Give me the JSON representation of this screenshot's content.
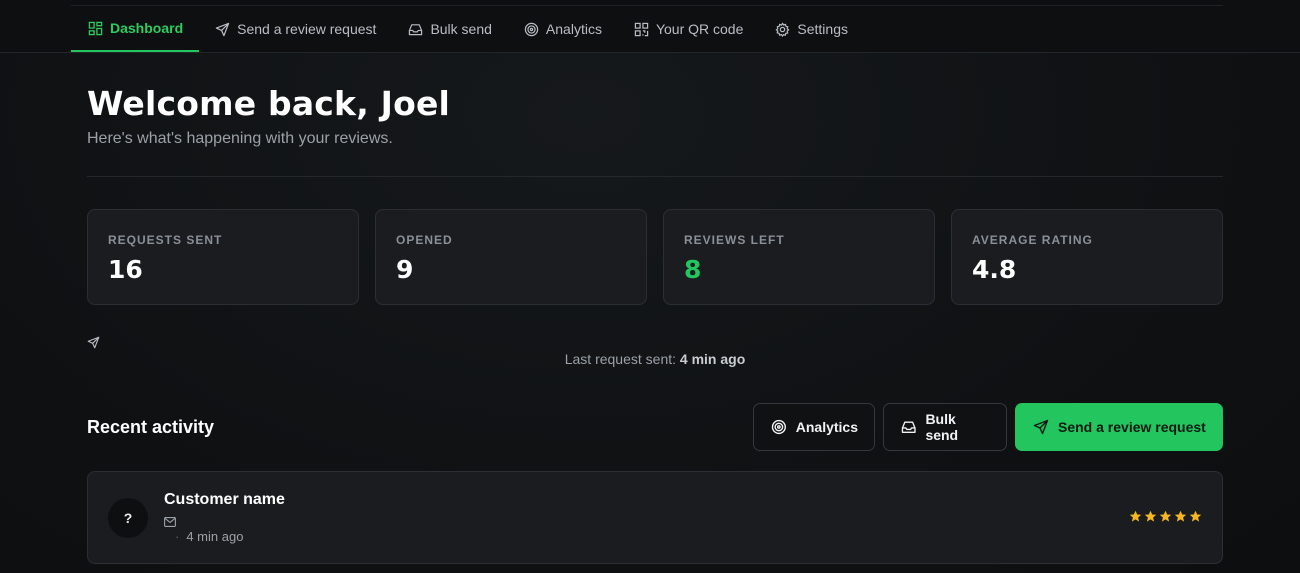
{
  "nav": {
    "items": [
      {
        "label": "Dashboard",
        "icon": "grid-icon",
        "active": true
      },
      {
        "label": "Send a review request",
        "icon": "send-icon",
        "active": false
      },
      {
        "label": "Bulk send",
        "icon": "inbox-icon",
        "active": false
      },
      {
        "label": "Analytics",
        "icon": "target-icon",
        "active": false
      },
      {
        "label": "Your QR code",
        "icon": "qr-code-icon",
        "active": false
      },
      {
        "label": "Settings",
        "icon": "gear-icon",
        "active": false
      }
    ]
  },
  "header": {
    "title": "Welcome back, Joel",
    "subtitle": "Here's what's happening with your reviews."
  },
  "stats": [
    {
      "label": "REQUESTS SENT",
      "value": "16"
    },
    {
      "label": "OPENED",
      "value": "9"
    },
    {
      "label": "REVIEWS LEFT",
      "value": "8"
    },
    {
      "label": "AVERAGE RATING",
      "value": "4.8"
    }
  ],
  "last_sent": {
    "prefix": "Last request sent: ",
    "value": "4 min ago"
  },
  "recent": {
    "title": "Recent activity",
    "buttons": {
      "analytics": "Analytics",
      "bulk": "Bulk send",
      "send": "Send a review request"
    },
    "rows": [
      {
        "avatar": "?",
        "name": "Customer name",
        "dot": "·",
        "time": "4 min ago",
        "rating": 5
      }
    ]
  },
  "colors": {
    "accent": "#22c55e",
    "star": "#f5b724",
    "background": "#0f1113",
    "card": "#1a1c20"
  }
}
